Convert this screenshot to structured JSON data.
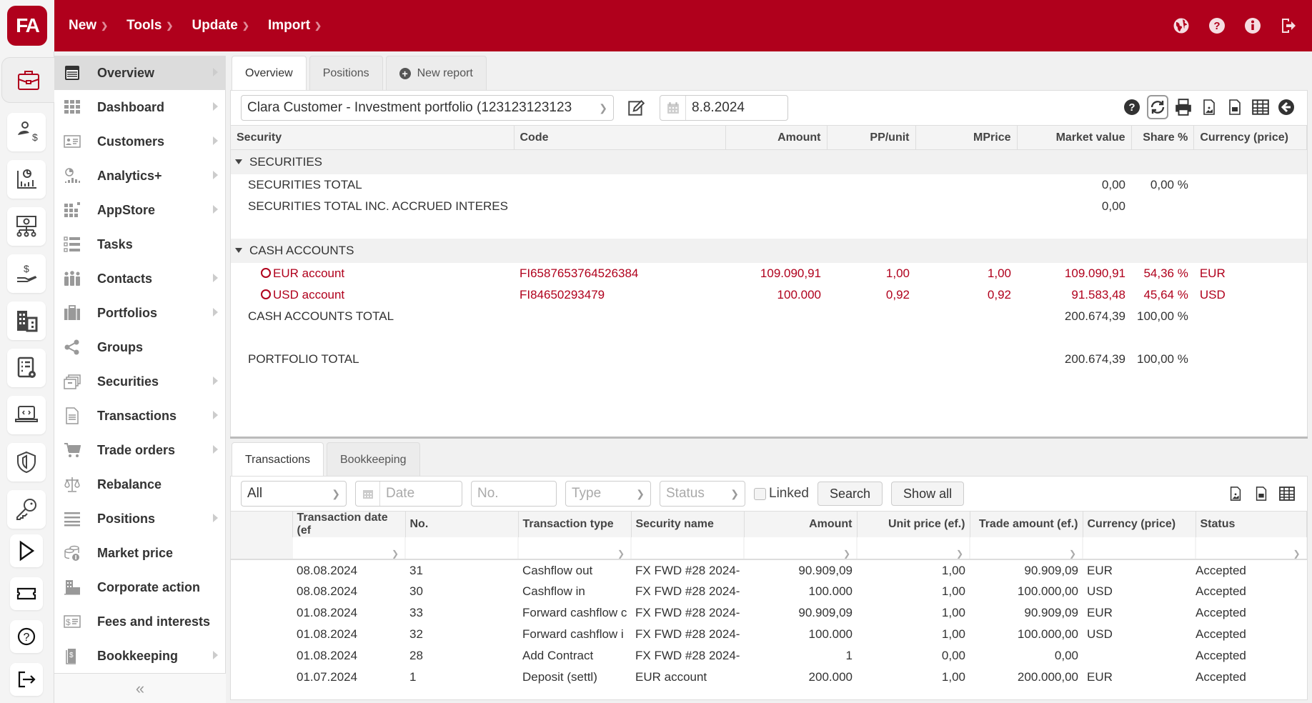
{
  "app": {
    "logo_text": "FA"
  },
  "topmenu": [
    {
      "label": "New"
    },
    {
      "label": "Tools"
    },
    {
      "label": "Update"
    },
    {
      "label": "Import"
    }
  ],
  "topicons": [
    "globe-icon",
    "help-icon",
    "info-icon",
    "logout-icon"
  ],
  "rail": [
    "portfolio-briefcase-icon",
    "client-money-icon",
    "analytics-report-icon",
    "cash-hierarchy-icon",
    "money-hand-icon",
    "building-icon",
    "settings-list-icon",
    "code-laptop-icon",
    "shield-icon",
    "key-icon",
    "play-icon",
    "ticket-icon",
    "help-circle-icon",
    "exit-icon"
  ],
  "sidebar": {
    "items": [
      {
        "label": "Overview",
        "icon": "overview-icon",
        "submenu": true,
        "active": true
      },
      {
        "label": "Dashboard",
        "icon": "dashboard-icon",
        "submenu": true
      },
      {
        "label": "Customers",
        "icon": "customers-icon",
        "submenu": true
      },
      {
        "label": "Analytics+",
        "icon": "analytics-icon",
        "submenu": true
      },
      {
        "label": "AppStore",
        "icon": "appstore-icon",
        "submenu": true
      },
      {
        "label": "Tasks",
        "icon": "tasks-icon",
        "submenu": false
      },
      {
        "label": "Contacts",
        "icon": "contacts-icon",
        "submenu": true
      },
      {
        "label": "Portfolios",
        "icon": "portfolios-icon",
        "submenu": true
      },
      {
        "label": "Groups",
        "icon": "groups-icon",
        "submenu": false
      },
      {
        "label": "Securities",
        "icon": "securities-icon",
        "submenu": true
      },
      {
        "label": "Transactions",
        "icon": "transactions-icon",
        "submenu": true
      },
      {
        "label": "Trade orders",
        "icon": "cart-icon",
        "submenu": true
      },
      {
        "label": "Rebalance",
        "icon": "scale-icon",
        "submenu": false
      },
      {
        "label": "Positions",
        "icon": "positions-icon",
        "submenu": true
      },
      {
        "label": "Market price",
        "icon": "coins-icon",
        "submenu": false
      },
      {
        "label": "Corporate action",
        "icon": "corporate-icon",
        "submenu": false
      },
      {
        "label": "Fees and interests",
        "icon": "fees-icon",
        "submenu": false
      },
      {
        "label": "Bookkeeping",
        "icon": "bookkeeping-icon",
        "submenu": true
      }
    ],
    "collapse_label": "«"
  },
  "main": {
    "tabs": [
      {
        "label": "Overview",
        "active": true
      },
      {
        "label": "Positions"
      },
      {
        "label": "New report",
        "plus": true
      }
    ],
    "portfolio_select": "Clara Customer - Investment portfolio  (123123123123",
    "date": "8.8.2024",
    "columns": [
      "Security",
      "Code",
      "Amount",
      "PP/unit",
      "MPrice",
      "Market value",
      "Share %",
      "Currency (price)"
    ],
    "rows": [
      {
        "type": "group",
        "security": "SECURITIES"
      },
      {
        "type": "total",
        "security": "SECURITIES TOTAL",
        "market_value": "0,00",
        "share": "0,00 %"
      },
      {
        "type": "total",
        "security": "SECURITIES TOTAL INC. ACCRUED INTERES",
        "market_value": "0,00"
      },
      {
        "type": "blank"
      },
      {
        "type": "group",
        "security": "CASH ACCOUNTS"
      },
      {
        "type": "item",
        "security": "EUR account",
        "code": "FI6587653764526384",
        "amount": "109.090,91",
        "pp_unit": "1,00",
        "mprice": "1,00",
        "market_value": "109.090,91",
        "share": "54,36 %",
        "currency": "EUR"
      },
      {
        "type": "item",
        "security": "USD account",
        "code": "FI84650293479",
        "amount": "100.000",
        "pp_unit": "0,92",
        "mprice": "0,92",
        "market_value": "91.583,48",
        "share": "45,64 %",
        "currency": "USD"
      },
      {
        "type": "total",
        "security": "CASH ACCOUNTS TOTAL",
        "market_value": "200.674,39",
        "share": "100,00 %"
      },
      {
        "type": "blank"
      },
      {
        "type": "total",
        "security": "PORTFOLIO TOTAL",
        "market_value": "200.674,39",
        "share": "100,00 %"
      }
    ]
  },
  "bottom": {
    "tabs": [
      {
        "label": "Transactions",
        "active": true
      },
      {
        "label": "Bookkeeping"
      }
    ],
    "filters": {
      "scope_value": "All",
      "date_placeholder": "Date",
      "no_placeholder": "No.",
      "type_placeholder": "Type",
      "status_placeholder": "Status",
      "linked_label": "Linked",
      "linked_checked": false,
      "search_label": "Search",
      "showall_label": "Show all"
    },
    "columns": [
      "",
      "Transaction date (ef",
      "No.",
      "Transaction type",
      "Security name",
      "Amount",
      "Unit price (ef.)",
      "Trade amount (ef.)",
      "Currency (price)",
      "Status"
    ],
    "rows": [
      {
        "date": "08.08.2024",
        "no": "31",
        "type": "Cashflow out",
        "security": "FX FWD #28 2024-",
        "amount": "90.909,09",
        "unit_price": "1,00",
        "trade_amount": "90.909,09",
        "currency": "EUR",
        "status": "Accepted"
      },
      {
        "date": "08.08.2024",
        "no": "30",
        "type": "Cashflow in",
        "security": "FX FWD #28 2024-",
        "amount": "100.000",
        "unit_price": "1,00",
        "trade_amount": "100.000,00",
        "currency": "USD",
        "status": "Accepted"
      },
      {
        "date": "01.08.2024",
        "no": "33",
        "type": "Forward cashflow c",
        "security": "FX FWD #28 2024-",
        "amount": "90.909,09",
        "unit_price": "1,00",
        "trade_amount": "90.909,09",
        "currency": "EUR",
        "status": "Accepted"
      },
      {
        "date": "01.08.2024",
        "no": "32",
        "type": "Forward cashflow i",
        "security": "FX FWD #28 2024-",
        "amount": "100.000",
        "unit_price": "1,00",
        "trade_amount": "100.000,00",
        "currency": "USD",
        "status": "Accepted"
      },
      {
        "date": "01.08.2024",
        "no": "28",
        "type": "Add Contract",
        "security": "FX FWD #28 2024-",
        "amount": "1",
        "unit_price": "0,00",
        "trade_amount": "0,00",
        "currency": "",
        "status": "Accepted"
      },
      {
        "date": "01.07.2024",
        "no": "1",
        "type": "Deposit (settl)",
        "security": "EUR account",
        "amount": "200.000",
        "unit_price": "1,00",
        "trade_amount": "200.000,00",
        "currency": "EUR",
        "status": "Accepted"
      }
    ]
  },
  "colors": {
    "brand": "#b0001c",
    "text": "#333333",
    "accent_text": "#b0001c"
  }
}
